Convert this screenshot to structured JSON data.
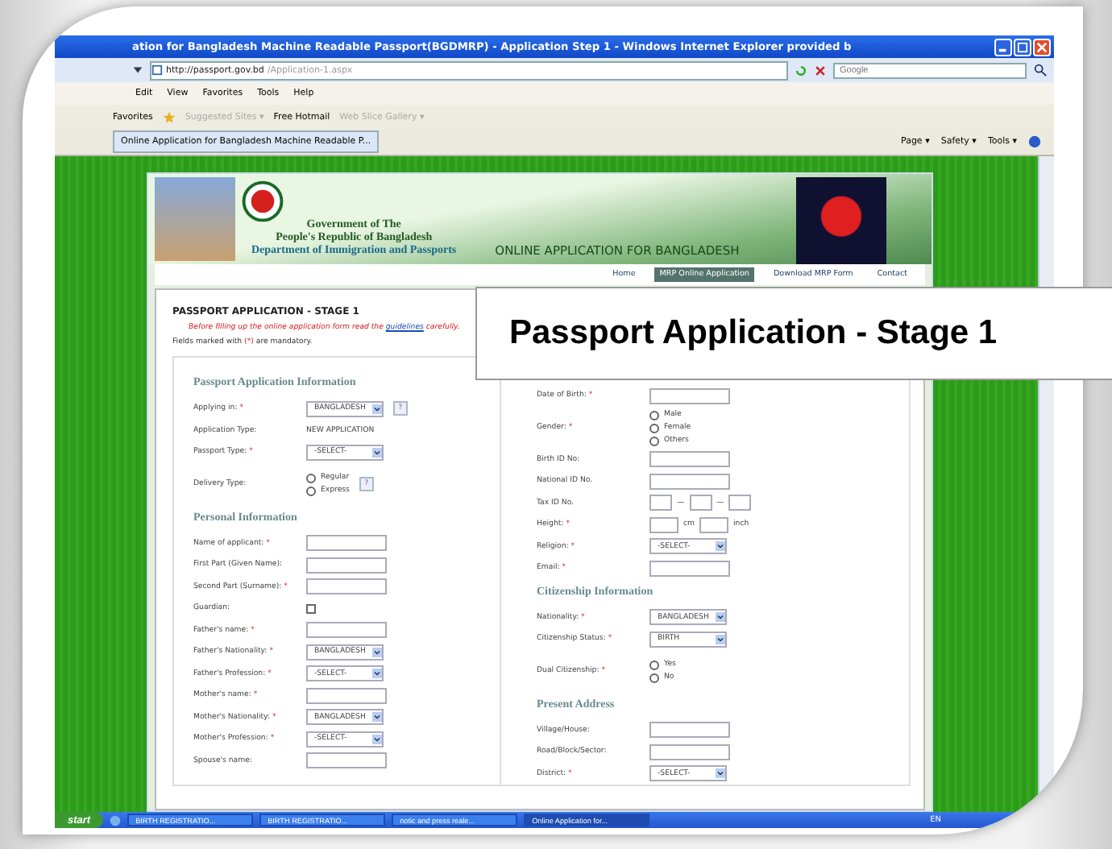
{
  "window": {
    "title": "ation for Bangladesh Machine Readable Passport(BGDMRP) - Application Step 1 - Windows Internet Explorer provided b",
    "address": {
      "host": "http://passport.gov.bd",
      "path": "/Application-1.aspx"
    },
    "search_placeholder": "Google"
  },
  "menu": [
    "Edit",
    "View",
    "Favorites",
    "Tools",
    "Help"
  ],
  "favorites_bar": {
    "label": "Favorites",
    "items": [
      {
        "label": "Suggested Sites ▾",
        "disabled": true
      },
      {
        "label": "Free Hotmail",
        "disabled": false
      },
      {
        "label": "Web Slice Gallery ▾",
        "disabled": true
      }
    ]
  },
  "tab": {
    "title": "Online Application for Bangladesh Machine Readable P..."
  },
  "command_bar": [
    "Page ▾",
    "Safety ▾",
    "Tools ▾"
  ],
  "banner": {
    "lines": [
      "Government of The",
      "People's Republic of Bangladesh",
      "Department of Immigration and Passports"
    ],
    "tagline": "ONLINE APPLICATION FOR BANGLADESH"
  },
  "nav": [
    {
      "label": "Home",
      "selected": false
    },
    {
      "label": "MRP Online Application",
      "selected": true
    },
    {
      "label": "Download MRP Form",
      "selected": false
    },
    {
      "label": "Contact",
      "selected": false
    }
  ],
  "stage_title": "PASSPORT APPLICATION - STAGE 1",
  "instruction": {
    "before": "Before filling up the online application form read the",
    "link": "guidelines",
    "after": "carefully."
  },
  "mandatory_note": {
    "before": "Fields marked with",
    "mark": "(*)",
    "after": "are mandatory."
  },
  "left_fields": [
    {
      "kind": "heading",
      "label": "Passport Application Information"
    },
    {
      "kind": "select",
      "label": "Applying in:",
      "mark": "*",
      "value": "BANGLADESH",
      "help": "?"
    },
    {
      "kind": "static",
      "label": "Application Type:",
      "value": "NEW APPLICATION"
    },
    {
      "kind": "select",
      "label": "Passport Type:",
      "mark": "*",
      "value": "-SELECT-"
    },
    {
      "kind": "radio",
      "label": "Delivery Type:",
      "help": "?",
      "options": [
        {
          "label": "Regular",
          "selected": false
        },
        {
          "label": "Express",
          "selected": false
        }
      ]
    },
    {
      "kind": "heading",
      "label": "Personal Information"
    },
    {
      "kind": "text",
      "label": "Name of applicant:",
      "mark": "*"
    },
    {
      "kind": "text",
      "label": "First Part (Given Name):"
    },
    {
      "kind": "text",
      "label": "Second Part (Surname):",
      "mark": "*"
    },
    {
      "kind": "checkbox",
      "label": "Guardian:",
      "checked": false
    },
    {
      "kind": "text",
      "label": "Father's name:",
      "mark": "*"
    },
    {
      "kind": "select",
      "label": "Father's Nationality:",
      "mark": "*",
      "value": "BANGLADESH"
    },
    {
      "kind": "select",
      "label": "Father's Profession:",
      "mark": "*",
      "value": "-SELECT-"
    },
    {
      "kind": "text",
      "label": "Mother's name:",
      "mark": "*"
    },
    {
      "kind": "select",
      "label": "Mother's Nationality:",
      "mark": "*",
      "value": "BANGLADESH"
    },
    {
      "kind": "select",
      "label": "Mother's Profession:",
      "mark": "*",
      "value": "-SELECT-"
    },
    {
      "kind": "text",
      "label": "Spouse's name:"
    }
  ],
  "right_fields": [
    {
      "kind": "text",
      "label": "Date of Birth:",
      "mark": "*"
    },
    {
      "kind": "radio",
      "label": "Gender:",
      "mark": "*",
      "options": [
        {
          "label": "Male",
          "selected": false
        },
        {
          "label": "Female",
          "selected": false
        },
        {
          "label": "Others",
          "selected": false
        }
      ]
    },
    {
      "kind": "text",
      "label": "Birth ID No:"
    },
    {
      "kind": "text",
      "label": "National ID No."
    },
    {
      "kind": "split",
      "label": "Tax ID No.",
      "separators": [
        "—",
        "—"
      ]
    },
    {
      "kind": "height",
      "label": "Height:",
      "mark": "*",
      "units": [
        "cm",
        "inch"
      ]
    },
    {
      "kind": "select",
      "label": "Religion:",
      "mark": "*",
      "value": "-SELECT-"
    },
    {
      "kind": "text",
      "label": "Email:",
      "mark": "*"
    },
    {
      "kind": "heading",
      "label": "Citizenship Information"
    },
    {
      "kind": "select",
      "label": "Nationality:",
      "mark": "*",
      "value": "BANGLADESH"
    },
    {
      "kind": "select",
      "label": "Citizenship Status:",
      "mark": "*",
      "value": "BIRTH"
    },
    {
      "kind": "radio",
      "label": "Dual Citizenship:",
      "mark": "*",
      "options": [
        {
          "label": "Yes",
          "selected": false
        },
        {
          "label": "No",
          "selected": false
        }
      ]
    },
    {
      "kind": "heading",
      "label": "Present Address"
    },
    {
      "kind": "text",
      "label": "Village/House:"
    },
    {
      "kind": "text",
      "label": "Road/Block/Sector:"
    },
    {
      "kind": "select",
      "label": "District:",
      "mark": "*",
      "value": "-SELECT-"
    }
  ],
  "callout": "Passport Application - Stage 1",
  "taskbar": {
    "start": "start",
    "tasks": [
      {
        "label": "BIRTH REGISTRATIO...",
        "selected": false
      },
      {
        "label": "BIRTH REGISTRATIO...",
        "selected": false
      },
      {
        "label": "notic and press reale...",
        "selected": false
      },
      {
        "label": "Online Application for...",
        "selected": true
      }
    ],
    "language": "EN"
  }
}
